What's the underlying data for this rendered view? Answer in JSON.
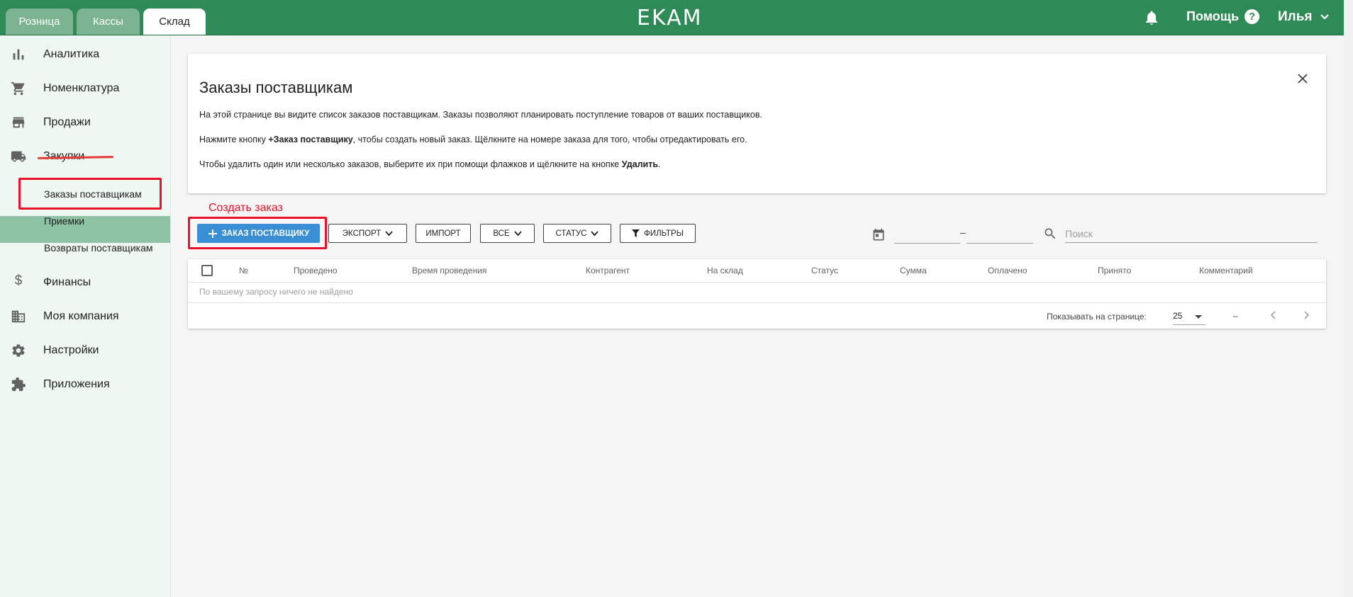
{
  "topbar": {
    "tabs": [
      {
        "label": "Розница",
        "active": false
      },
      {
        "label": "Кассы",
        "active": false
      },
      {
        "label": "Склад",
        "active": true
      }
    ],
    "logo": "EKAM",
    "help_label": "Помощь",
    "help_icon_glyph": "?",
    "user_name": "Илья",
    "icons": {
      "notifications": "bell-icon",
      "user_menu": "chevron-down-icon"
    }
  },
  "colors": {
    "brand_green": "#2e8b57",
    "active_submenu": "#8dc3a4",
    "primary_button": "#3a8fd4",
    "annotation_red": "#e8132a"
  },
  "sidebar": {
    "items": [
      {
        "label": "Аналитика",
        "icon": "bar-chart-icon"
      },
      {
        "label": "Номенклатура",
        "icon": "cart-icon"
      },
      {
        "label": "Продажи",
        "icon": "store-icon"
      },
      {
        "label": "Закупки",
        "icon": "truck-icon"
      },
      {
        "label": "Финансы",
        "icon": "dollar-icon"
      },
      {
        "label": "Моя компания",
        "icon": "building-icon"
      },
      {
        "label": "Настройки",
        "icon": "gear-icon"
      },
      {
        "label": "Приложения",
        "icon": "puzzle-icon"
      }
    ],
    "subitems": [
      {
        "label": "Заказы поставщикам",
        "active": true
      },
      {
        "label": "Приемки",
        "active": false
      },
      {
        "label": "Возвраты поставщикам",
        "active": false
      }
    ]
  },
  "info": {
    "title": "Заказы поставщикам",
    "p1": "На этой странице вы видите список заказов поставщикам. Заказы позволяют планировать поступление товаров от ваших поставщиков.",
    "p2_before": "Нажмите кнопку ",
    "p2_bold": "+Заказ поставщику",
    "p2_after": ", чтобы создать новый заказ. Щёлкните на номере заказа для того, чтобы отредактировать его.",
    "p3_before": "Чтобы удалить один или несколько заказов, выберите их при помощи флажков и щёлкните на кнопке ",
    "p3_bold": "Удалить",
    "p3_after": "."
  },
  "annotation": {
    "create_order": "Создать заказ"
  },
  "toolbar": {
    "add_order": "ЗАКАЗ ПОСТАВЩИКУ",
    "export": "ЭКСПОРТ",
    "import": "ИМПОРТ",
    "all": "ВСЕ",
    "status": "СТАТУС",
    "filters": "ФИЛЬТРЫ",
    "date_separator": "–",
    "search_placeholder": "Поиск"
  },
  "table": {
    "columns": [
      "№",
      "Проведено",
      "Время проведения",
      "Контрагент",
      "На склад",
      "Статус",
      "Сумма",
      "Оплачено",
      "Принято",
      "Комментарий"
    ],
    "empty_text": "По вашему запросу ничего не найдено",
    "per_page_label": "Показывать на странице:",
    "per_page_value": "25",
    "range": "–"
  }
}
